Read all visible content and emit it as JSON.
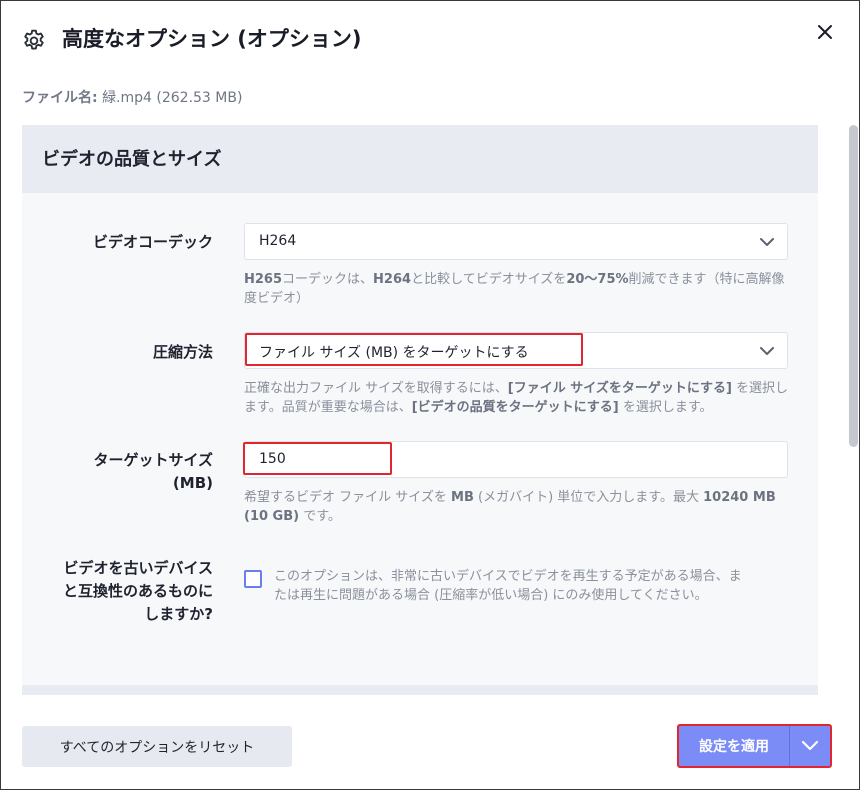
{
  "dialog": {
    "title": "高度なオプション (オプション)",
    "file_label": "ファイル名:",
    "file_value": "緑.mp4 (262.53 MB)"
  },
  "section": {
    "title": "ビデオの品質とサイズ"
  },
  "codec": {
    "label": "ビデオコーデック",
    "value": "H264",
    "help_bold_1": "H265",
    "help_1": "コーデックは、",
    "help_bold_2": "H264",
    "help_2": "と比較してビデオサイズを",
    "help_bold_3": "20〜75%",
    "help_3": "削減できます（特に高解像度ビデオ）"
  },
  "compression": {
    "label": "圧縮方法",
    "value": "ファイル サイズ (MB) をターゲットにする",
    "help_1": "正確な出力ファイル サイズを取得するには、",
    "help_bold_1": "[ファイル サイズをターゲットにする]",
    "help_2": " を選択します。品質が重要な場合は、",
    "help_bold_2": "[ビデオの品質をターゲットにする]",
    "help_3": " を選択します。"
  },
  "target_size": {
    "label_line1": "ターゲットサイズ",
    "label_line2": "(MB)",
    "value": "150",
    "help_1": "希望するビデオ ファイル サイズを ",
    "help_bold_1": "MB",
    "help_2": " (メガバイト) 単位で入力します。最大 ",
    "help_bold_2": "10240 MB (10 GB)",
    "help_3": " です。"
  },
  "compat": {
    "label_line1": "ビデオを古いデバイス",
    "label_line2": "と互換性のあるものに",
    "label_line3": "しますか?",
    "help": "このオプションは、非常に古いデバイスでビデオを再生する予定がある場合、または再生に問題がある場合 (圧縮率が低い場合) にのみ使用してください。"
  },
  "footer": {
    "reset_label": "すべてのオプションをリセット",
    "apply_label": "設定を適用"
  },
  "colors": {
    "accent": "#7b8cf7",
    "highlight": "#e0262e",
    "panel_header": "#e8ebf1"
  },
  "icons": {
    "title": "gear-icon",
    "close": "close-icon",
    "dropdown": "chevron-down-icon"
  }
}
